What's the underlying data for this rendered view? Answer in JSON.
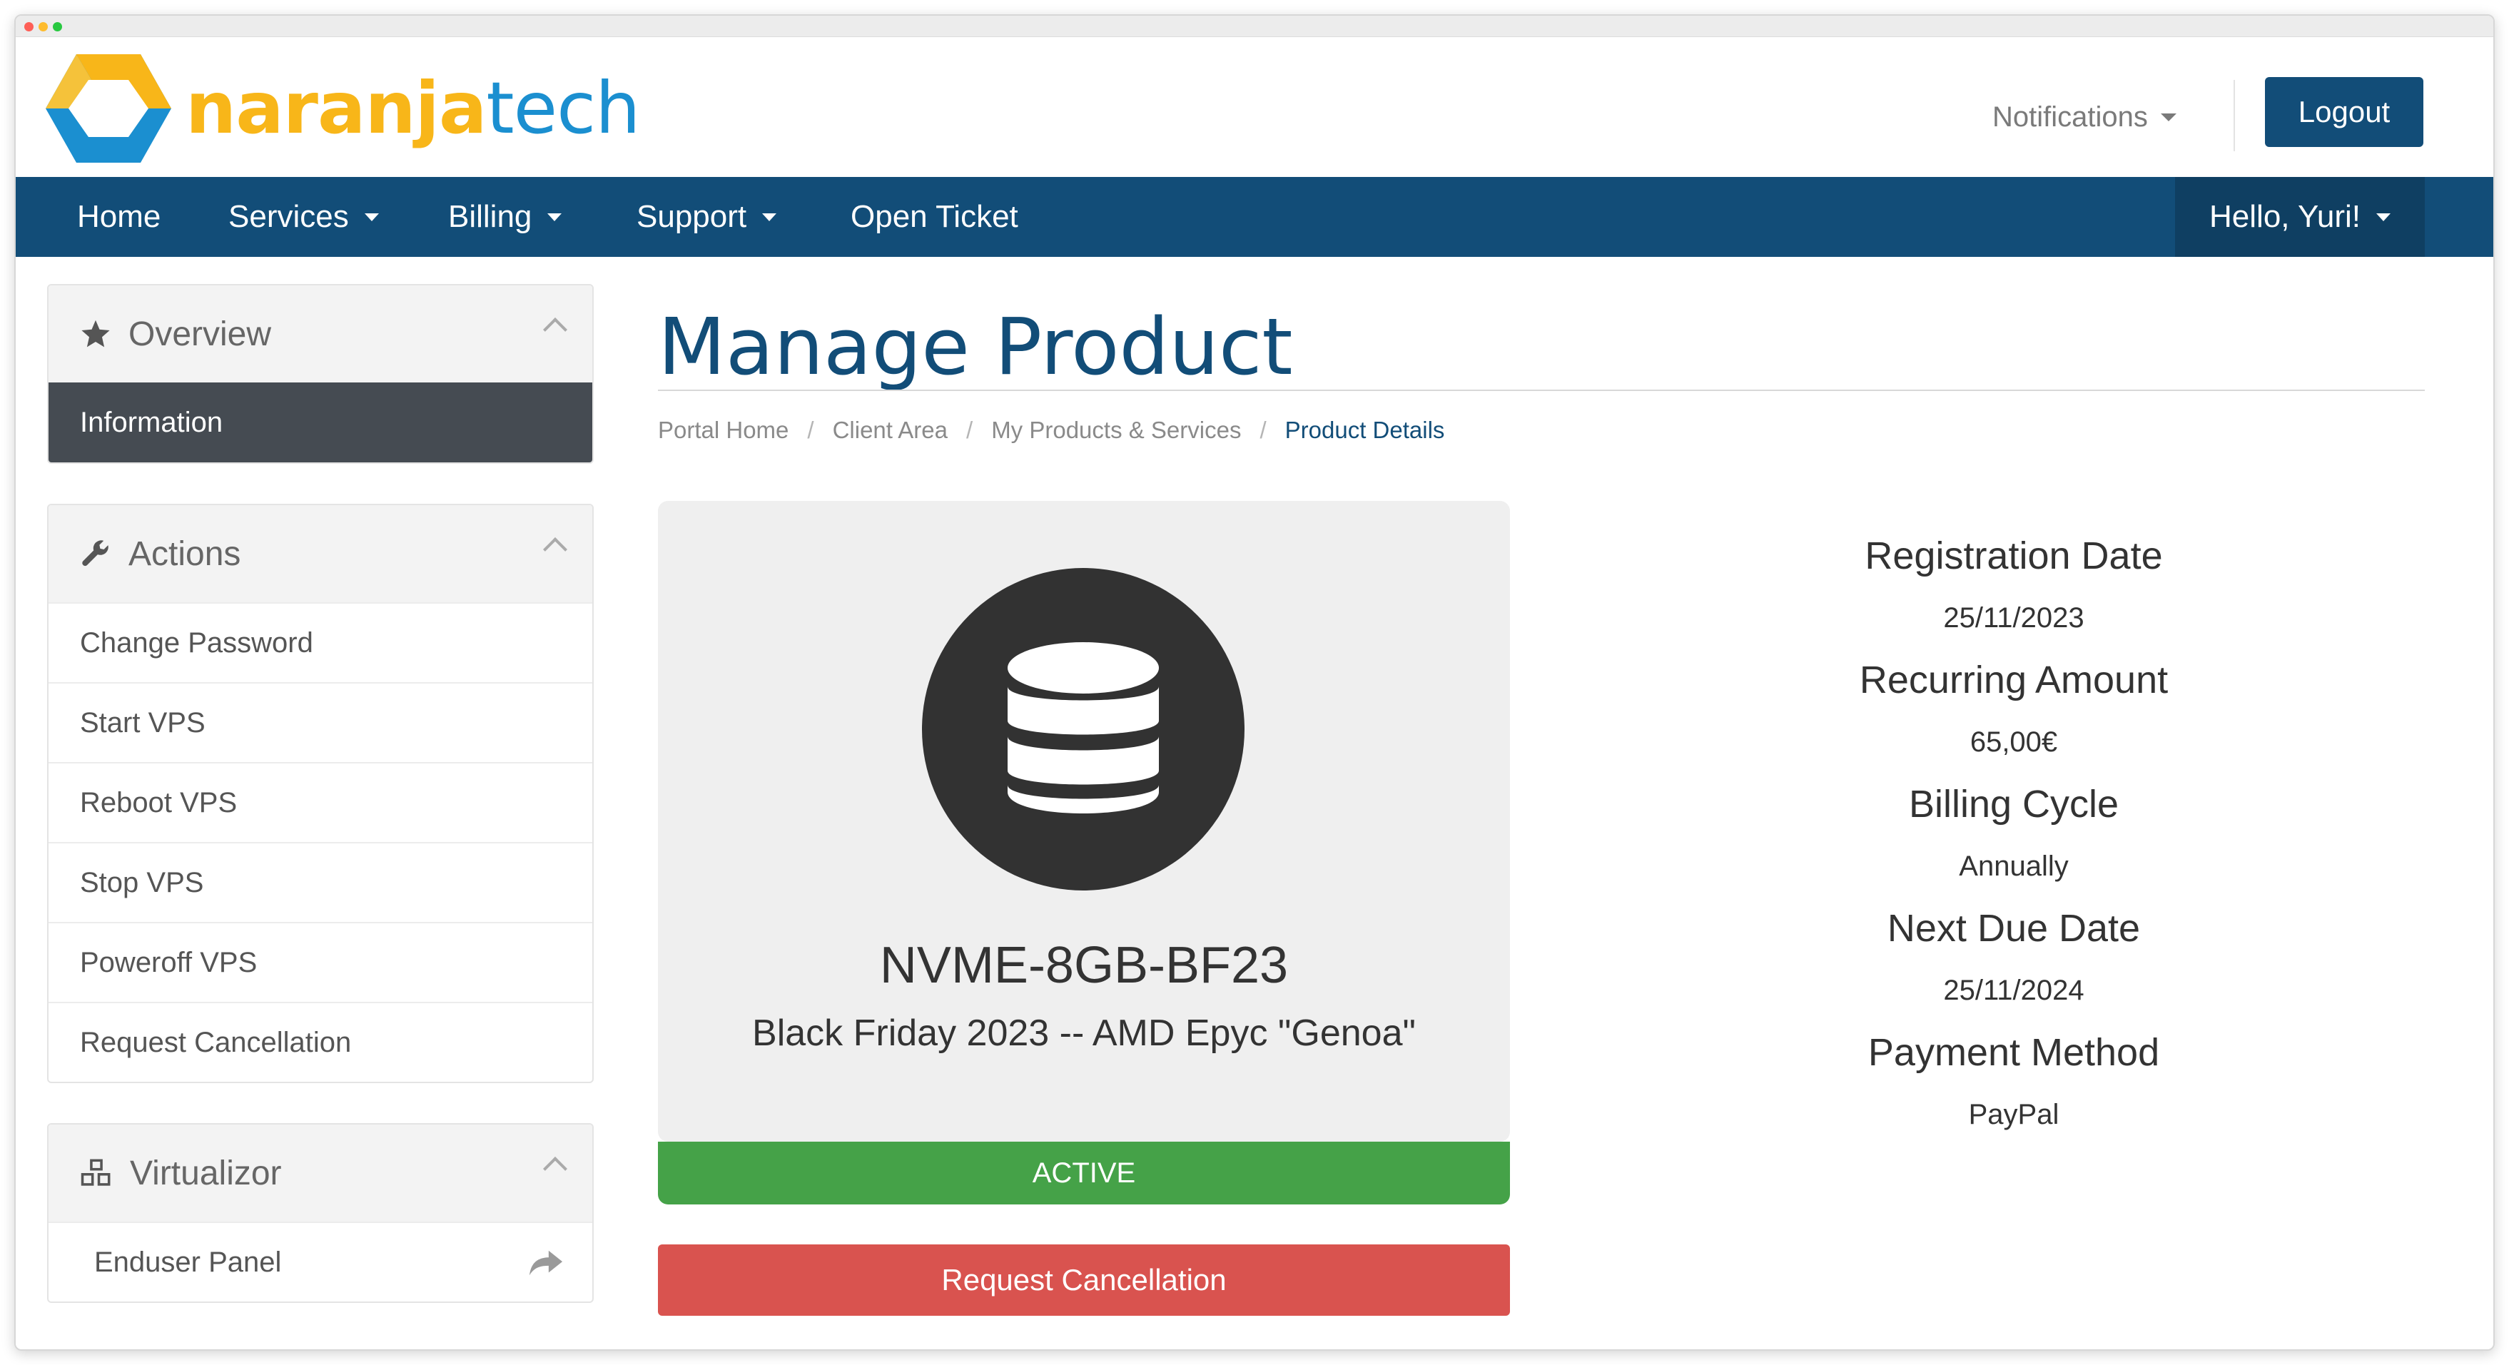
{
  "brand": {
    "name_part1": "naranja",
    "name_part2": "tech"
  },
  "header": {
    "notifications_label": "Notifications",
    "logout_label": "Logout"
  },
  "nav": {
    "items": [
      {
        "label": "Home"
      },
      {
        "label": "Services"
      },
      {
        "label": "Billing"
      },
      {
        "label": "Support"
      },
      {
        "label": "Open Ticket"
      }
    ],
    "user_label": "Hello, Yuri!"
  },
  "sidebar": {
    "overview": {
      "title": "Overview",
      "icon": "star-icon",
      "items": [
        {
          "label": "Information"
        }
      ]
    },
    "actions": {
      "title": "Actions",
      "icon": "wrench-icon",
      "items": [
        {
          "label": "Change Password"
        },
        {
          "label": "Start VPS"
        },
        {
          "label": "Reboot VPS"
        },
        {
          "label": "Stop VPS"
        },
        {
          "label": "Poweroff VPS"
        },
        {
          "label": "Request Cancellation"
        }
      ]
    },
    "virtualizor": {
      "title": "Virtualizor",
      "icon": "cubes-icon",
      "items": [
        {
          "label": "Enduser Panel",
          "icon": "share-icon"
        }
      ]
    }
  },
  "main": {
    "title": "Manage Product",
    "breadcrumb": [
      "Portal Home",
      "Client Area",
      "My Products & Services",
      "Product Details"
    ],
    "product": {
      "icon": "database-icon",
      "name": "NVME-8GB-BF23",
      "description": "Black Friday 2023 -- AMD Epyc \"Genoa\"",
      "status": "ACTIVE",
      "cancel_label": "Request Cancellation"
    },
    "details": [
      {
        "label": "Registration Date",
        "value": "25/11/2023"
      },
      {
        "label": "Recurring Amount",
        "value": "65,00€"
      },
      {
        "label": "Billing Cycle",
        "value": "Annually"
      },
      {
        "label": "Next Due Date",
        "value": "25/11/2024"
      },
      {
        "label": "Payment Method",
        "value": "PayPal"
      }
    ]
  },
  "colors": {
    "brand_primary": "#124d78",
    "status_active": "#45a248",
    "danger": "#d9534f",
    "logo_orange": "#f8b619",
    "logo_blue": "#1b8fd0"
  }
}
